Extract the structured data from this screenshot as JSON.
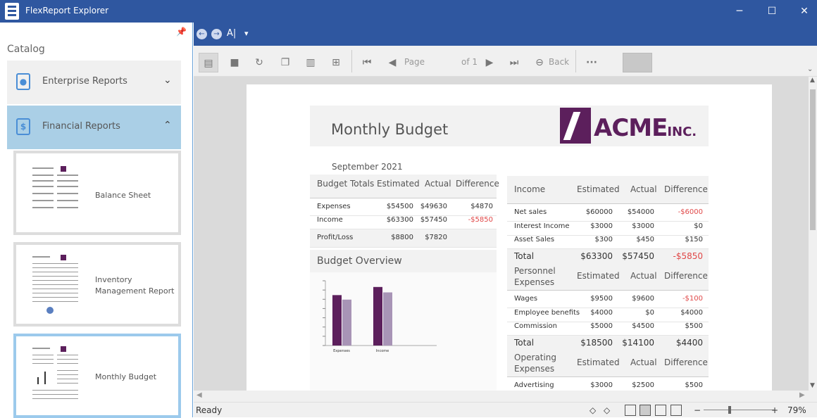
{
  "window": {
    "title": "FlexReport Explorer",
    "minimize": "─",
    "maximize": "☐",
    "close": "✕"
  },
  "sidebar": {
    "pin": "📌",
    "catalog_label": "Catalog",
    "categories": [
      {
        "label": "Enterprise Reports",
        "chevron": "⌄"
      },
      {
        "label": "Financial Reports",
        "chevron": "⌃"
      }
    ],
    "reports": [
      {
        "label": "Balance Sheet"
      },
      {
        "label": "Inventory\nManagement Report"
      },
      {
        "label": "Monthly Budget"
      }
    ]
  },
  "ribbon": {
    "back": "←",
    "forward": "→",
    "text_tool": "A|",
    "dropdown": "▾"
  },
  "toolbar": {
    "page_label": "Page",
    "page_value": "",
    "of_label": "of 1",
    "back_label": "Back",
    "more": "···",
    "icons": [
      "document-icon",
      "stop-icon",
      "refresh-icon",
      "copy-icon",
      "side-pane-icon",
      "fit-icon",
      "first-page-icon",
      "prev-page-icon",
      "next-page-icon",
      "last-page-icon",
      "back-icon"
    ]
  },
  "report": {
    "title": "Monthly Budget",
    "logo_text": "ACME",
    "logo_suffix": "INC.",
    "date": "September 2021",
    "budget_totals": {
      "headers": [
        "Budget Totals",
        "Estimated",
        "Actual",
        "Difference"
      ],
      "rows": [
        [
          "Expenses",
          "$54500",
          "$49630",
          "$4870"
        ],
        [
          "Income",
          "$63300",
          "$57450",
          "-$5850"
        ],
        [
          "Profit/Loss",
          "$8800",
          "$7820",
          ""
        ]
      ]
    },
    "overview_title": "Budget Overview",
    "income": {
      "headers": [
        "Income",
        "Estimated",
        "Actual",
        "Difference"
      ],
      "rows": [
        [
          "Net sales",
          "$60000",
          "$54000",
          "-$6000"
        ],
        [
          "Interest Income",
          "$3000",
          "$3000",
          "$0"
        ],
        [
          "Asset Sales",
          "$300",
          "$450",
          "$150"
        ]
      ],
      "total": [
        "Total",
        "$63300",
        "$57450",
        "-$5850"
      ]
    },
    "personnel": {
      "headers": [
        "Personnel\nExpenses",
        "Estimated",
        "Actual",
        "Difference"
      ],
      "rows": [
        [
          "Wages",
          "$9500",
          "$9600",
          "-$100"
        ],
        [
          "Employee benefits",
          "$4000",
          "$0",
          "$4000"
        ],
        [
          "Commission",
          "$5000",
          "$4500",
          "$500"
        ]
      ],
      "total": [
        "Total",
        "$18500",
        "$14100",
        "$4400"
      ]
    },
    "operating": {
      "headers": [
        "Operating\nExpenses",
        "Estimated",
        "Actual",
        "Difference"
      ],
      "rows": [
        [
          "Advertising",
          "$3000",
          "$2500",
          "$500"
        ]
      ]
    }
  },
  "chart_data": {
    "type": "bar",
    "categories": [
      "Expenses",
      "Income"
    ],
    "series": [
      {
        "values": [
          54500,
          63300
        ]
      },
      {
        "values": [
          49630,
          57450
        ]
      }
    ],
    "colors": [
      "#5c1f5c",
      "#a894b6"
    ]
  },
  "statusbar": {
    "status": "Ready",
    "zoom": "79%",
    "zoom_minus": "−",
    "zoom_plus": "+",
    "nav_left": "◇",
    "nav_right": "◇"
  }
}
